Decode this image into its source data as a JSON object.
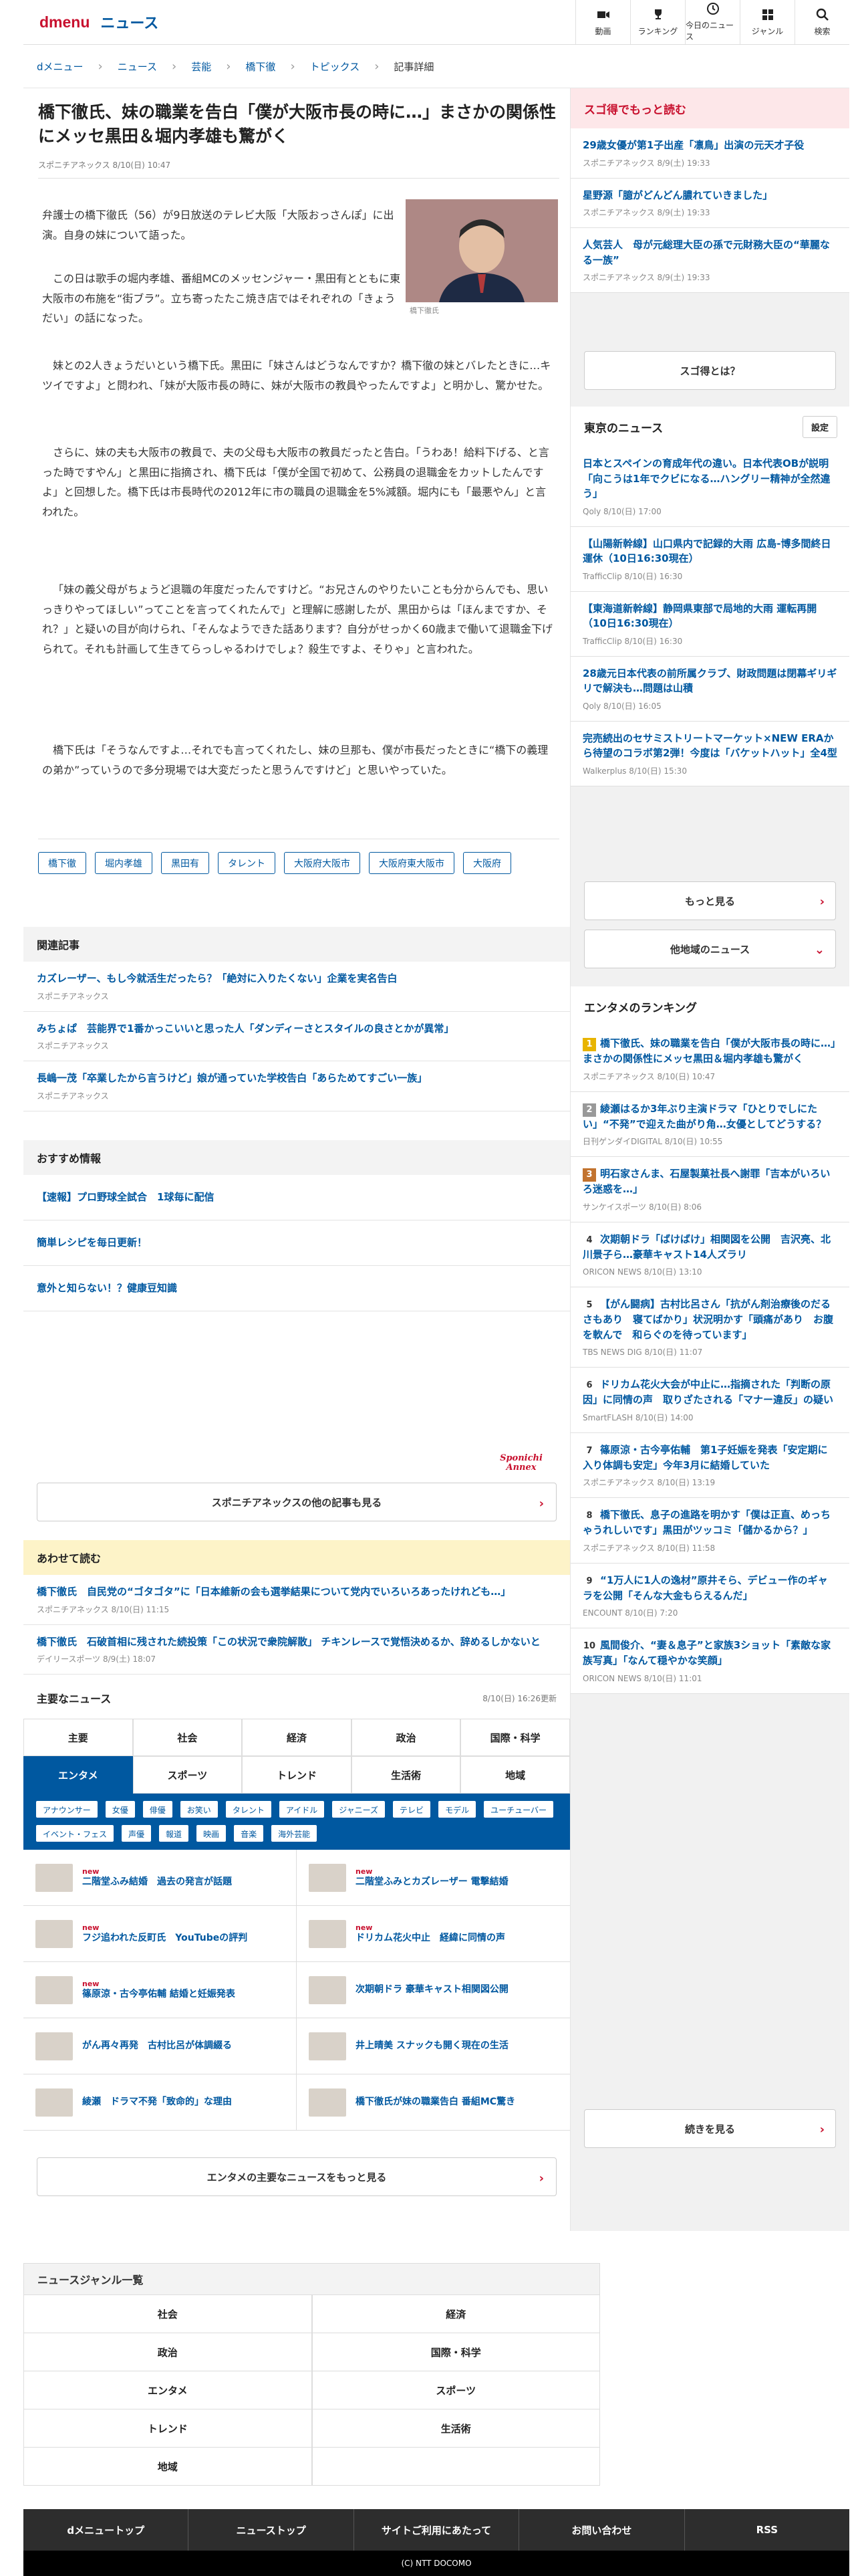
{
  "header": {
    "logo_d": "dmenu",
    "logo_n": "ニュース",
    "icons": [
      {
        "label": "動画",
        "icon": "video-icon"
      },
      {
        "label": "ランキング",
        "icon": "trophy-icon"
      },
      {
        "label": "今日のニュース",
        "icon": "clock-icon"
      },
      {
        "label": "ジャンル",
        "icon": "grid-icon"
      },
      {
        "label": "検索",
        "icon": "search-icon"
      }
    ]
  },
  "breadcrumb": [
    "dメニュー",
    "ニュース",
    "芸能",
    "橋下徹",
    "トピックス",
    "記事詳細"
  ],
  "article": {
    "title": "橋下徹氏、妹の職業を告白「僕が大阪市長の時に…」まさかの関係性にメッセ黒田＆堀内孝雄も驚がく",
    "source": "スポニチアネックス",
    "date": "8/10(日) 10:47",
    "photo_caption": "橋下徹氏",
    "p1": "弁護士の橋下徹氏（56）が9日放送のテレビ大阪「大阪おっさんぽ」に出演。自身の妹について語った。",
    "p2": "この日は歌手の堀内孝雄、番組MCのメッセンジャー・黒田有とともに東大阪市の布施を“街ブラ”。立ち寄ったたこ焼き店ではそれぞれの「きょうだい」の話になった。",
    "p3": "妹との2人きょうだいという橋下氏。黒田に「妹さんはどうなんですか？橋下徹の妹とバレたときに…キツイですよ」と問われ、「妹が大阪市長の時に、妹が大阪市の教員やったんですよ」と明かし、驚かせた。",
    "p4": "さらに、妹の夫も大阪市の教員で、夫の父母も大阪市の教員だったと告白。「うわあ！給料下げる、と言った時ですやん」と黒田に指摘され、橋下氏は「僕が全国で初めて、公務員の退職金をカットしたんですよ」と回想した。橋下氏は市長時代の2012年に市の職員の退職金を5%減額。堀内にも「最悪やん」と言われた。",
    "p5": "「妹の義父母がちょうど退職の年度だったんですけど。“お兄さんのやりたいことも分からんでも、思いっきりやってほしい”ってことを言ってくれたんで」と理解に感謝したが、黒田からは「ほんまですか、それ？」と疑いの目が向けられ、「そんなようできた話あります？自分がせっかく60歳まで働いて退職金下げられて。それも計画して生きてらっしゃるわけでしょ？殺生ですよ、そりゃ」と言われた。",
    "p6": "橋下氏は「そうなんですよ…それでも言ってくれたし、妹の旦那も、僕が市長だったときに“橋下の義理の弟か”っていうので多分現場では大変だったと思うんですけど」と思いやっていた。",
    "tags": [
      "橋下徹",
      "堀内孝雄",
      "黒田有",
      "タレント",
      "大阪府大阪市",
      "大阪府東大阪市",
      "大阪府"
    ]
  },
  "related": {
    "heading": "関連記事",
    "items": [
      {
        "title": "カズレーザー、もし今就活生だったら？「絶対に入りたくない」企業を実名告白",
        "source": "スポニチアネックス"
      },
      {
        "title": "みちょぱ　芸能界で1番かっこいいと思った人「ダンディーさとスタイルの良さとかが異常」",
        "source": "スポニチアネックス"
      },
      {
        "title": "長嶋一茂「卒業したから言うけど」娘が通っていた学校告白「あらためてすごい一族」",
        "source": "スポニチアネックス"
      }
    ]
  },
  "recommend": {
    "heading": "おすすめ情報",
    "items": [
      "【速報】プロ野球全試合　1球毎に配信",
      "簡単レシピを毎日更新！",
      "意外と知らない！？健康豆知識"
    ],
    "logo": "Sponichi Annex",
    "more": "スポニチアネックスの他の記事も見る"
  },
  "alsoread": {
    "heading": "あわせて読む",
    "items": [
      {
        "title": "橋下徹氏　自民党の“ゴタゴタ”に「日本維新の会も選挙結果について党内でいろいろあったけれども…」",
        "source": "スポニチアネックス 8/10(日) 11:15"
      },
      {
        "title": "橋下徹氏　石破首相に残された続投策「この状況で衆院解散」 チキンレースで覚悟決めるか、辞めるしかないと",
        "source": "デイリースポーツ 8/9(土) 18:07"
      }
    ]
  },
  "major": {
    "heading": "主要なニュース",
    "updated": "8/10(日) 16:26更新",
    "tabs": [
      "主要",
      "社会",
      "経済",
      "政治",
      "国際・科学",
      "エンタメ",
      "スポーツ",
      "トレンド",
      "生活術",
      "地域"
    ],
    "subtags": [
      "アナウンサー",
      "女優",
      "俳優",
      "お笑い",
      "タレント",
      "アイドル",
      "ジャニーズ",
      "テレビ",
      "モデル",
      "ユーチューバー",
      "イベント・フェス",
      "声優",
      "報道",
      "映画",
      "音楽",
      "海外芸能"
    ],
    "news": [
      {
        "title": "二階堂ふみ結婚　過去の発言が話題",
        "new": "new"
      },
      {
        "title": "二階堂ふみとカズレーザー 電撃結婚",
        "new": "new"
      },
      {
        "title": "フジ追われた反町氏　YouTubeの評判",
        "new": "new"
      },
      {
        "title": "ドリカム花火中止　経緯に同情の声",
        "new": "new"
      },
      {
        "title": "篠原涼・古今亭佑輔 結婚と妊娠発表",
        "new": "new"
      },
      {
        "title": "次期朝ドラ 豪華キャスト相関図公開",
        "new": ""
      },
      {
        "title": "がん再々再発　古村比呂が体調綴る",
        "new": ""
      },
      {
        "title": "井上晴美 スナックも開く現在の生活",
        "new": ""
      },
      {
        "title": "綾瀬　ドラマ不発「致命的」な理由",
        "new": ""
      },
      {
        "title": "橋下徹氏が妹の職業告白 番組MC驚き",
        "new": ""
      }
    ],
    "more": "エンタメの主要なニュースをもっと見る"
  },
  "sidebar": {
    "sugotoku": {
      "heading": "スゴ得でもっと読む",
      "items": [
        {
          "title": "29歳女優が第1子出産「凛鳥」出演の元天才子役",
          "source": "スポニチアネックス 8/9(土) 19:33"
        },
        {
          "title": "星野源「臆がどんどん膿れていきました」",
          "source": "スポニチアネックス 8/9(土) 19:33"
        },
        {
          "title": "人気芸人　母が元総理大臣の孫で元財務大臣の“華麗なる一族”",
          "source": "スポニチアネックス 8/9(土) 19:33"
        }
      ],
      "btn": "スゴ得とは？"
    },
    "tokyo": {
      "heading": "東京のニュース",
      "setting": "設定",
      "items": [
        {
          "title": "日本とスペインの育成年代の違い。日本代表OBが説明「向こうは1年でクビになる…ハングリー精神が全然違う」",
          "source": "Qoly 8/10(日) 17:00"
        },
        {
          "title": "【山陽新幹線】山口県内で記録的大雨 広島-博多間終日運休（10日16:30現在）",
          "source": "TrafficClip 8/10(日) 16:30"
        },
        {
          "title": "【東海道新幹線】静岡県東部で局地的大雨 運転再開（10日16:30現在）",
          "source": "TrafficClip 8/10(日) 16:30"
        },
        {
          "title": "28歳元日本代表の前所属クラブ、財政問題は閉幕ギリギリで解決も…問題は山積",
          "source": "Qoly 8/10(日) 16:05"
        },
        {
          "title": "完売続出のセサミストリートマーケット×NEW ERAから待望のコラボ第2弾！今度は「バケットハット」全4型",
          "source": "Walkerplus 8/10(日) 15:30"
        }
      ],
      "more": "もっと見る",
      "other": "他地域のニュース"
    },
    "ranking": {
      "heading": "エンタメのランキング",
      "items": [
        {
          "rank": "1",
          "title": "橋下徹氏、妹の職業を告白「僕が大阪市長の時に…」まさかの関係性にメッセ黒田＆堀内孝雄も驚がく",
          "source": "スポニチアネックス 8/10(日) 10:47"
        },
        {
          "rank": "2",
          "title": "綾瀬はるか3年ぶり主演ドラマ「ひとりでしにたい」“不発”で迎えた曲がり角…女優としてどうする？",
          "source": "日刊ゲンダイDIGITAL 8/10(日) 10:55"
        },
        {
          "rank": "3",
          "title": "明石家さんま、石屋製菓社長へ謝罪「吉本がいろいろ迷惑を…」",
          "source": "サンケイスポーツ 8/10(日) 8:06"
        },
        {
          "rank": "4",
          "title": "次期朝ドラ「ばけばけ」相関図を公開　吉沢亮、北川景子ら…豪華キャスト14人ズラリ",
          "source": "ORICON NEWS 8/10(日) 13:10"
        },
        {
          "rank": "5",
          "title": "【がん闘病】古村比呂さん「抗がん剤治療後のだるさもあり　寝てばかり」状況明かす「頭痛があり　お腹を軟んで　和らぐのを待っています」",
          "source": "TBS NEWS DIG 8/10(日) 11:07"
        },
        {
          "rank": "6",
          "title": "ドリカム花火大会が中止に…指摘された「判断の原因」に同情の声　取りざたされる「マナー違反」の疑い",
          "source": "SmartFLASH 8/10(日) 14:00"
        },
        {
          "rank": "7",
          "title": "篠原涼・古今亭佑輔　第1子妊娠を発表「安定期に入り体調も安定」今年3月に結婚していた",
          "source": "スポニチアネックス 8/10(日) 13:19"
        },
        {
          "rank": "8",
          "title": "橋下徹氏、息子の進路を明かす「僕は正直、めっちゃうれしいです」黒田がツッコミ「儲かるから？」",
          "source": "スポニチアネックス 8/10(日) 11:58"
        },
        {
          "rank": "9",
          "title": "“1万人に1人の逸材”原井そら、デビュー作のギャラを公開「そんな大金もらえるんだ」",
          "source": "ENCOUNT 8/10(日) 7:20"
        },
        {
          "rank": "10",
          "title": "風間俊介、“妻＆息子”と家族3ショット「素敵な家族写真」「なんて穏やかな笑顔」",
          "source": "ORICON NEWS 8/10(日) 11:01"
        }
      ],
      "more": "続きを見る"
    }
  },
  "genres": {
    "heading": "ニュースジャンル一覧",
    "items": [
      "社会",
      "経済",
      "政治",
      "国際・科学",
      "エンタメ",
      "スポーツ",
      "トレンド",
      "生活術",
      "地域"
    ]
  },
  "footer": {
    "links": [
      "dメニュートップ",
      "ニューストップ",
      "サイトご利用にあたって",
      "お問い合わせ",
      "RSS"
    ],
    "copyright": "(C) NTT DOCOMO"
  },
  "colors": {
    "brand": "#c8102e",
    "link": "#0058a0",
    "pink": "#fde7e9",
    "yellow": "#fdf3c8"
  }
}
